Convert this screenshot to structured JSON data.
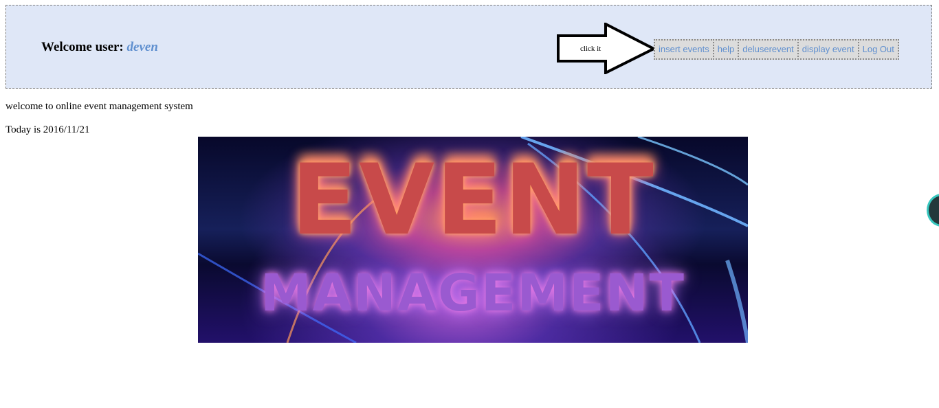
{
  "header": {
    "welcome_prefix": "Welcome user: ",
    "username": "deven",
    "callout": "click it",
    "nav": [
      {
        "label": "insert events",
        "name": "nav-insert-events"
      },
      {
        "label": "help",
        "name": "nav-help"
      },
      {
        "label": "deluserevent",
        "name": "nav-deluserevent"
      },
      {
        "label": "display event",
        "name": "nav-display-event"
      },
      {
        "label": "Log Out",
        "name": "nav-log-out"
      }
    ]
  },
  "main": {
    "welcome_message": "welcome to online event management system",
    "today_text": "Today is 2016/11/21",
    "banner": {
      "word1": "EVENT",
      "word2": "MANAGEMENT"
    }
  },
  "colors": {
    "header_bg": "#dfe7f7",
    "link": "#5f8fcf",
    "accent_icon": "#37c7bf"
  }
}
